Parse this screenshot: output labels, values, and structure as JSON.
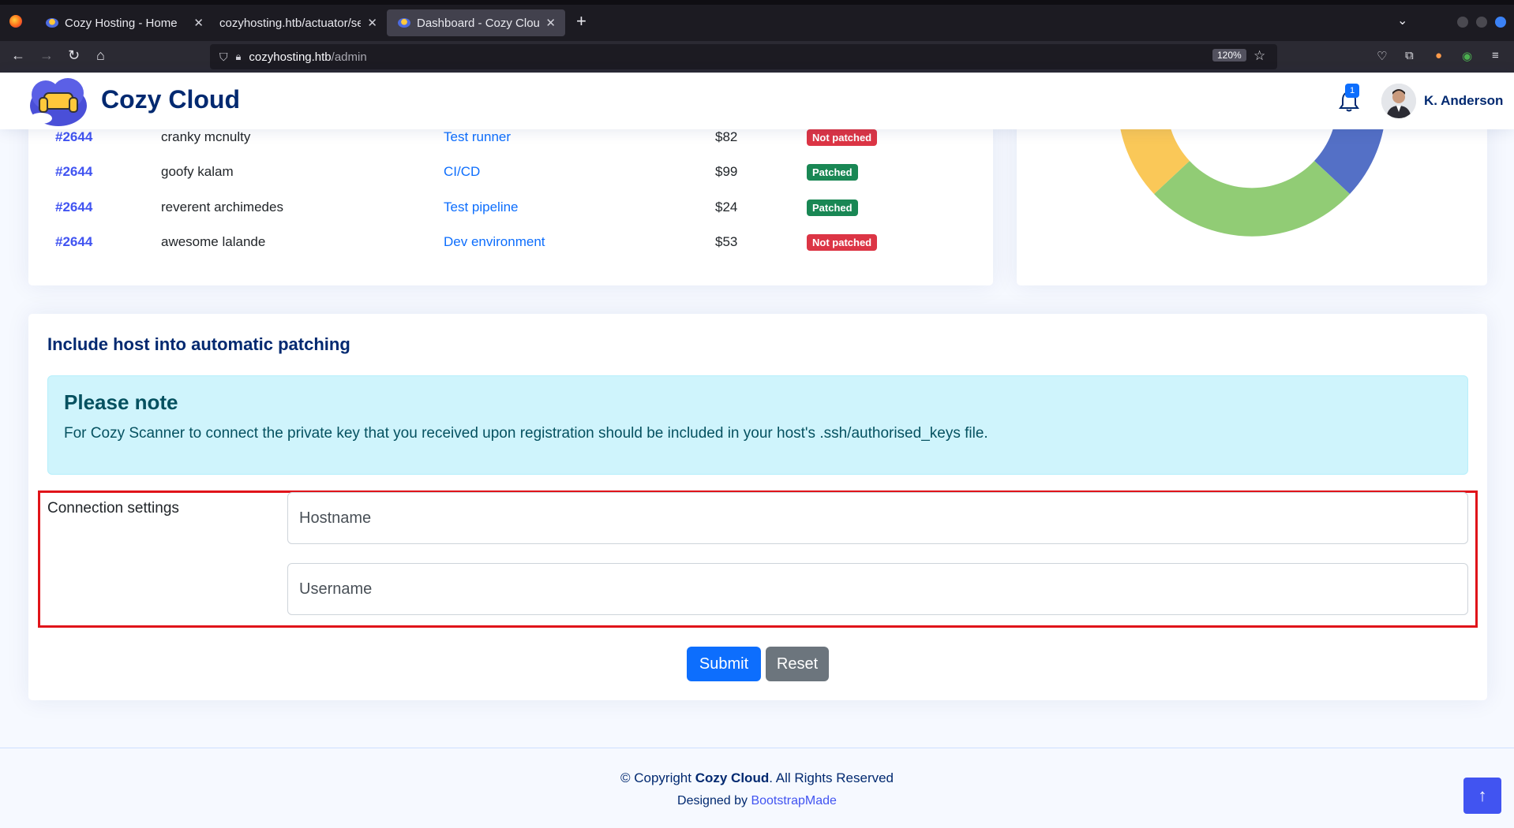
{
  "browser": {
    "tabs": [
      {
        "title": "Cozy Hosting - Home"
      },
      {
        "title": "cozyhosting.htb/actuator/se"
      },
      {
        "title": "Dashboard - Cozy Cloud"
      }
    ],
    "url_host": "cozyhosting.htb",
    "url_path": "/admin",
    "zoom": "120%"
  },
  "header": {
    "logo_text": "Cozy Cloud",
    "notification_count": "1",
    "user_name": "K. Anderson"
  },
  "orders": [
    {
      "id": "#2644",
      "customer": "cranky mcnulty",
      "product": "Test runner",
      "price": "$82",
      "status": "Not patched",
      "patched": false
    },
    {
      "id": "#2644",
      "customer": "goofy kalam",
      "product": "CI/CD",
      "price": "$99",
      "status": "Patched",
      "patched": true
    },
    {
      "id": "#2644",
      "customer": "reverent archimedes",
      "product": "Test pipeline",
      "price": "$24",
      "status": "Patched",
      "patched": true
    },
    {
      "id": "#2644",
      "customer": "awesome lalande",
      "product": "Dev environment",
      "price": "$53",
      "status": "Not patched",
      "patched": false
    }
  ],
  "chart_data": {
    "type": "pie",
    "colors": [
      "#5470c6",
      "#91cc75",
      "#fac858"
    ]
  },
  "form": {
    "title": "Include host into automatic patching",
    "alert_heading": "Please note",
    "alert_text": "For Cozy Scanner to connect the private key that you received upon registration should be included in your host's .ssh/authorised_keys file.",
    "connection_label": "Connection settings",
    "hostname_placeholder": "Hostname",
    "username_placeholder": "Username",
    "submit_label": "Submit",
    "reset_label": "Reset"
  },
  "footer": {
    "copyright_prefix": "© Copyright ",
    "company": "Cozy Cloud",
    "copyright_suffix": ". All Rights Reserved",
    "designed_by": "Designed by ",
    "designer": "BootstrapMade"
  }
}
